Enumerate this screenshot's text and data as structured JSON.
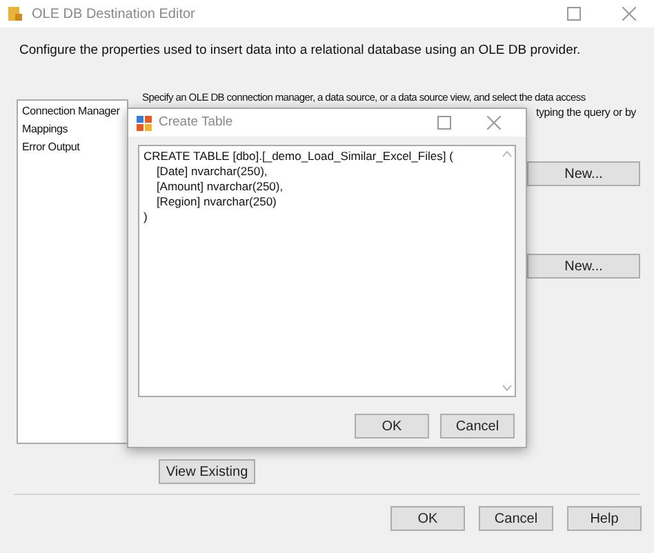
{
  "window": {
    "title": "OLE DB Destination Editor"
  },
  "description": "Configure the properties used to insert data into a relational database using an OLE DB provider.",
  "sidebar": {
    "items": [
      {
        "label": "Connection Manager",
        "selected": false
      },
      {
        "label": "Mappings",
        "selected": false
      },
      {
        "label": "Error Output",
        "selected": false
      }
    ]
  },
  "content": {
    "intro_line_1": "Specify an OLE DB connection manager, a data source, or a data source view, and select the data access",
    "intro_line_2_visible": "typing the query or by",
    "new_buttons": [
      "New...",
      "New..."
    ],
    "view_existing_button": "View Existing"
  },
  "dialog": {
    "title": "Create Table",
    "sql": "CREATE TABLE [dbo].[_demo_Load_Similar_Excel_Files] (\n    [Date] nvarchar(250),\n    [Amount] nvarchar(250),\n    [Region] nvarchar(250)\n)",
    "buttons": [
      "OK",
      "Cancel"
    ]
  },
  "buttons": [
    "OK",
    "Cancel",
    "Help"
  ]
}
